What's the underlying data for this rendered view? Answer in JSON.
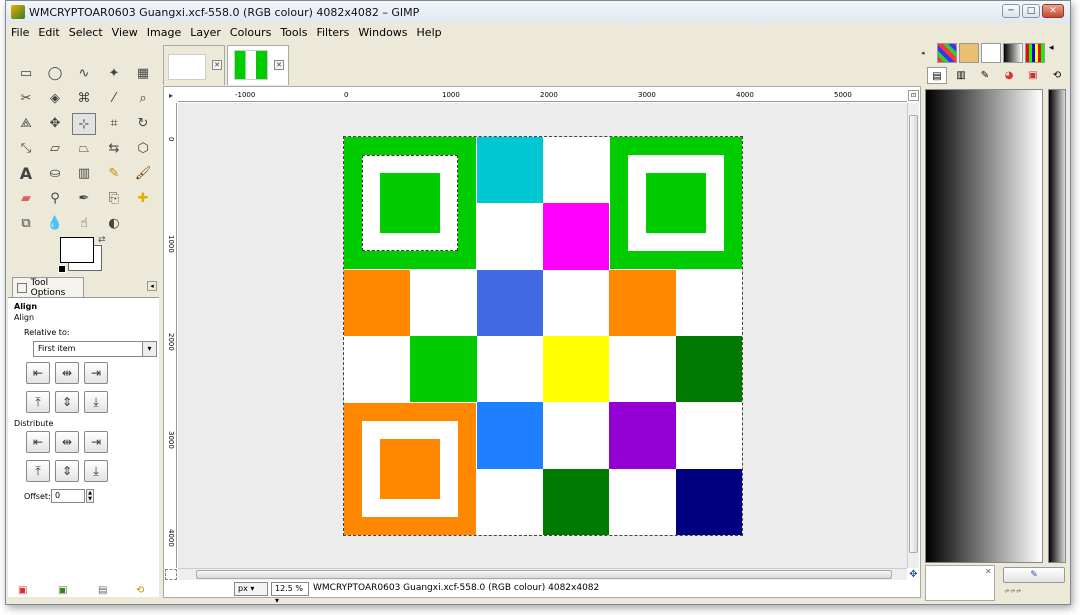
{
  "window": {
    "title": "WMCRYPTOAR0603 Guangxi.xcf-558.0 (RGB colour) 4082x4082 – GIMP",
    "controls": [
      "─",
      "□",
      "✕"
    ]
  },
  "menubar": [
    "File",
    "Edit",
    "Select",
    "View",
    "Image",
    "Layer",
    "Colours",
    "Tools",
    "Filters",
    "Windows",
    "Help"
  ],
  "tool_options": {
    "tab_label": "Tool Options",
    "tool_name": "Align",
    "section_align": "Align",
    "relative_to_label": "Relative to:",
    "relative_to_value": "First item",
    "distribute_label": "Distribute",
    "offset_label": "Offset:",
    "offset_value": "0"
  },
  "ruler": {
    "horizontal": [
      "-1000",
      "0",
      "1000",
      "2000",
      "3000",
      "4000",
      "5000"
    ],
    "vertical": [
      "0",
      "1000",
      "2000",
      "3000",
      "4000"
    ]
  },
  "status": {
    "unit": "px",
    "zoom": "12.5 %",
    "text": "WMCRYPTOAR0603 Guangxi.xcf-558.0 (RGB colour) 4082x4082"
  },
  "image": {
    "grid": [
      [
        "finder",
        "finder",
        "#00c8d2",
        "#ffffff",
        "finder",
        "finder"
      ],
      [
        "finder",
        "finder",
        "#ffffff",
        "#ff00ff",
        "finder",
        "finder"
      ],
      [
        "#ff8800",
        "#ffffff",
        "#4169e1",
        "#ffffff",
        "#ff8800",
        "#ffffff"
      ],
      [
        "#ffffff",
        "#00cc00",
        "#ffffff",
        "#ffff00",
        "#ffffff",
        "#007a00"
      ],
      [
        "finder",
        "finder",
        "#1e7fff",
        "#ffffff",
        "#9400d3",
        "#ffffff"
      ],
      [
        "finder",
        "finder",
        "#ffffff",
        "#007a00",
        "#ffffff",
        "#000080"
      ]
    ],
    "finder_colors": {
      "top_left": "#00cc00",
      "top_right": "#00cc00",
      "bottom_left": "#ff8800"
    }
  },
  "colors": {
    "accent_green": "#00cc00",
    "accent_orange": "#ff8800"
  }
}
